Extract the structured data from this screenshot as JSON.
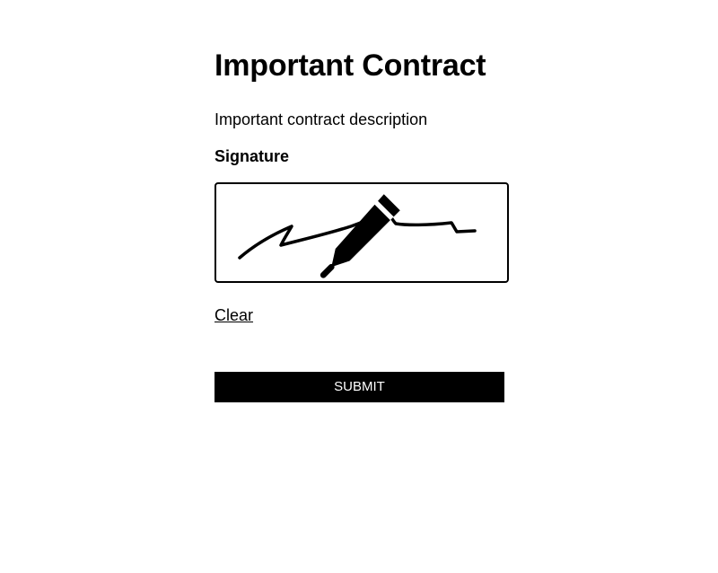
{
  "contract": {
    "title": "Important Contract",
    "description": "Important contract description"
  },
  "signature": {
    "label": "Signature",
    "stroke_color": "#000000",
    "pen_icon": "pen-icon"
  },
  "actions": {
    "clear_label": "Clear",
    "submit_label": "SUBMIT"
  },
  "colors": {
    "background": "#ffffff",
    "text": "#000000",
    "button_bg": "#000000",
    "button_text": "#ffffff"
  }
}
